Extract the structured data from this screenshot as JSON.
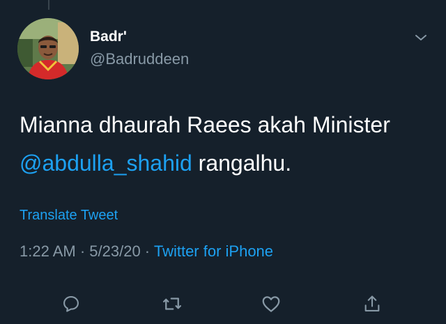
{
  "colors": {
    "background": "#15202b",
    "primary_text": "#ffffff",
    "secondary_text": "#8899a6",
    "accent": "#1da1f2",
    "border": "#38444d"
  },
  "author": {
    "display_name": "Badr'",
    "handle": "@Badruddeen",
    "avatar_icon": "profile-photo"
  },
  "menu": {
    "icon": "chevron-down-icon"
  },
  "tweet": {
    "text_before_mention": "Mianna dhaurah Raees akah Minister ",
    "mention": "@abdulla_shahid",
    "text_after_mention": " rangalhu."
  },
  "translate_label": "Translate Tweet",
  "meta": {
    "time": "1:22 AM",
    "separator": " · ",
    "date": "5/23/20",
    "source": "Twitter for iPhone"
  },
  "actions": [
    {
      "name": "reply",
      "icon": "reply-icon"
    },
    {
      "name": "retweet",
      "icon": "retweet-icon"
    },
    {
      "name": "like",
      "icon": "heart-icon"
    },
    {
      "name": "share",
      "icon": "share-icon"
    }
  ]
}
